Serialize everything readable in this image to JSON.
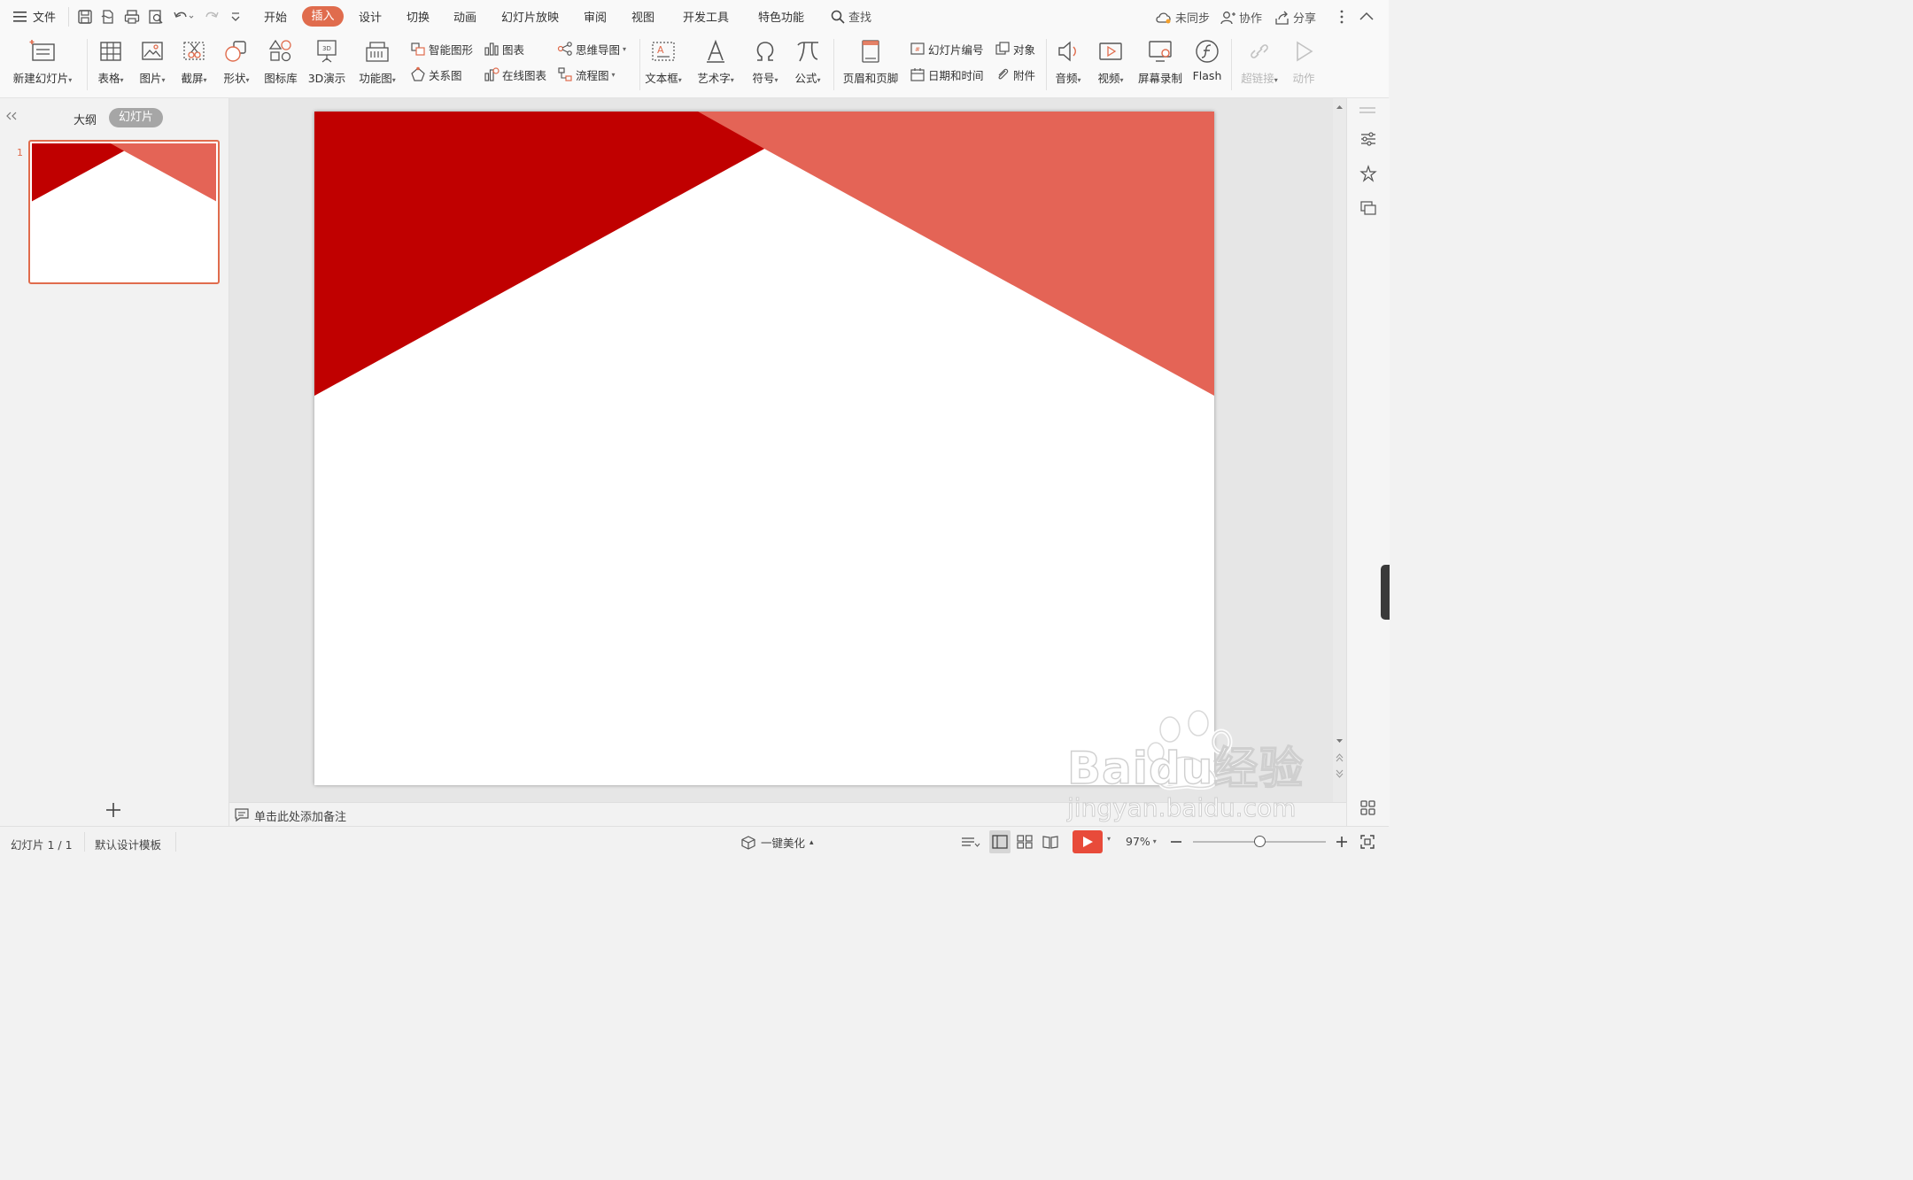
{
  "menubar": {
    "file_label": "文件",
    "tabs": [
      {
        "label": "开始"
      },
      {
        "label": "插入"
      },
      {
        "label": "设计"
      },
      {
        "label": "切换"
      },
      {
        "label": "动画"
      },
      {
        "label": "幻灯片放映"
      },
      {
        "label": "审阅"
      },
      {
        "label": "视图"
      },
      {
        "label": "开发工具"
      },
      {
        "label": "特色功能"
      }
    ],
    "active_tab": "插入",
    "search_label": "查找",
    "sync_label": "未同步",
    "collab_label": "协作",
    "share_label": "分享"
  },
  "ribbon": {
    "new_slide": "新建幻灯片",
    "table": "表格",
    "picture": "图片",
    "screenshot": "截屏",
    "shape": "形状",
    "icon_lib": "图标库",
    "demo3d": "3D演示",
    "func_chart": "功能图",
    "smart_shape": "智能图形",
    "chart": "图表",
    "relation": "关系图",
    "online_chart": "在线图表",
    "mindmap": "思维导图",
    "flowchart": "流程图",
    "textbox": "文本框",
    "wordart": "艺术字",
    "symbol": "符号",
    "formula": "公式",
    "header_footer": "页眉和页脚",
    "slide_number": "幻灯片编号",
    "object": "对象",
    "datetime": "日期和时间",
    "attachment": "附件",
    "audio": "音频",
    "video": "视频",
    "screen_record": "屏幕录制",
    "flash": "Flash",
    "hyperlink": "超链接",
    "action": "动作"
  },
  "leftpanel": {
    "tab_outline": "大纲",
    "tab_slides": "幻灯片",
    "slide_number": "1"
  },
  "notes": {
    "placeholder": "单击此处添加备注"
  },
  "statusbar": {
    "slide_info": "幻灯片 1 / 1",
    "template": "默认设计模板",
    "beautify": "一键美化",
    "zoom": "97%",
    "zoom_level": 0.5
  },
  "watermark": {
    "brand": "Baidu经验",
    "url": "jingyan.baidu.com"
  },
  "colors": {
    "accent": "#e06c4d",
    "dark_red": "#c00000",
    "light_red": "#e46456"
  }
}
